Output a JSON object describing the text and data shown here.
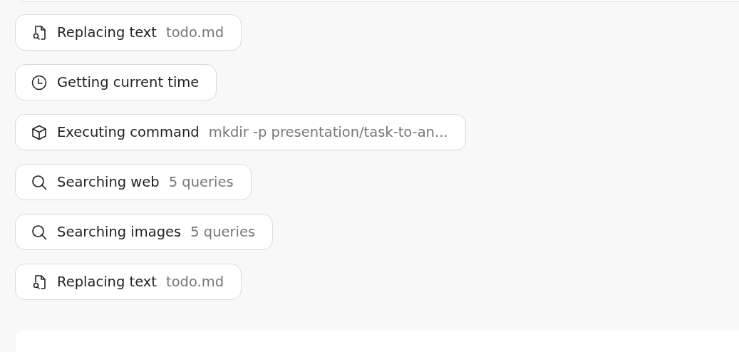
{
  "steps": [
    {
      "kind": "replace",
      "label": "Replacing text",
      "detail": "todo.md"
    },
    {
      "kind": "time",
      "label": "Getting current time"
    },
    {
      "kind": "command",
      "label": "Executing command",
      "detail": "mkdir -p presentation/task-to-an..."
    },
    {
      "kind": "search",
      "label": "Searching web",
      "detail": "5 queries"
    },
    {
      "kind": "search",
      "label": "Searching images",
      "detail": "5 queries"
    },
    {
      "kind": "replace",
      "label": "Replacing text",
      "detail": "todo.md"
    }
  ]
}
